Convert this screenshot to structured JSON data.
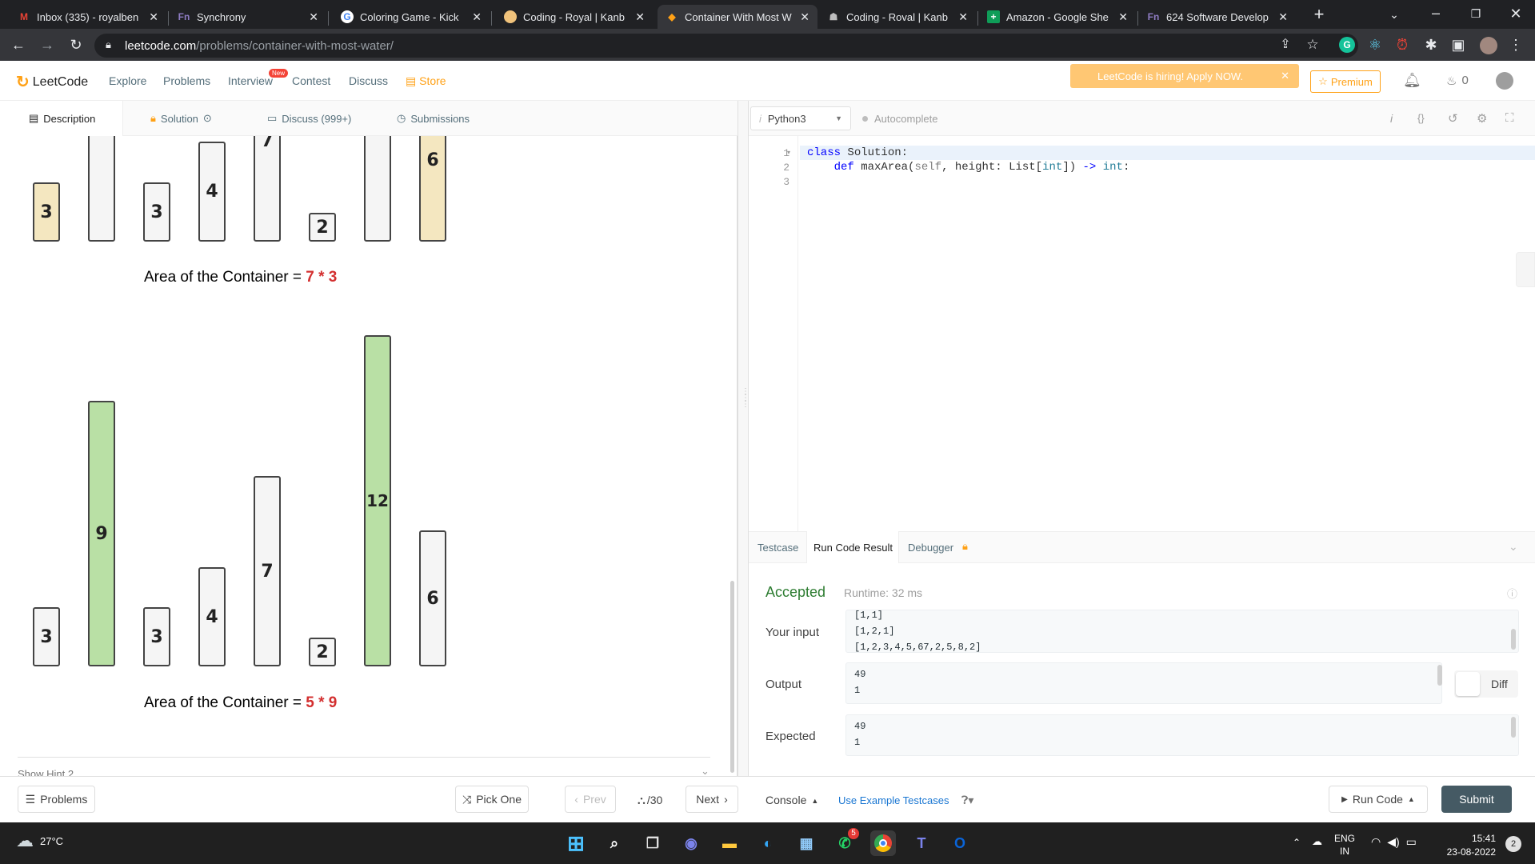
{
  "browser": {
    "tabs": [
      {
        "title": "Inbox (335) - royalben",
        "icon": "gmail-icon",
        "active": false
      },
      {
        "title": "Synchrony",
        "icon": "fn-icon",
        "active": false
      },
      {
        "title": "Coloring Game - Kick",
        "icon": "google-icon",
        "active": false
      },
      {
        "title": "Coding - Royal | Kanb",
        "icon": "avatar-icon",
        "active": false
      },
      {
        "title": "Container With Most W",
        "icon": "leetcode-icon",
        "active": true
      },
      {
        "title": "Coding - Roval | Kanb",
        "icon": "robot-icon",
        "active": false
      },
      {
        "title": "Amazon - Google She",
        "icon": "sheets-icon",
        "active": false
      },
      {
        "title": "624 Software Develop",
        "icon": "fn-icon",
        "active": false
      }
    ],
    "url_host": "leetcode.com",
    "url_path": "/problems/container-with-most-water/"
  },
  "nav": {
    "logo": "LeetCode",
    "links": [
      "Explore",
      "Problems",
      "Interview",
      "Contest",
      "Discuss"
    ],
    "new_badge": "New",
    "store": "Store",
    "hiring_banner": "LeetCode is hiring! Apply NOW.",
    "premium": "Premium",
    "streak": "0"
  },
  "problem_tabs": {
    "description": "Description",
    "solution": "Solution",
    "discuss": "Discuss (999+)",
    "submissions": "Submissions"
  },
  "description": {
    "figure1": {
      "bars": [
        "3",
        "",
        "3",
        "4",
        "7",
        "2",
        "",
        "6"
      ],
      "caption_prefix": "Area of the Container = ",
      "caption_value": "7 * 3"
    },
    "figure2": {
      "bars": [
        "3",
        "9",
        "3",
        "4",
        "7",
        "2",
        "12",
        "6"
      ],
      "caption_prefix": "Area of the Container = ",
      "caption_value": "5 * 9"
    },
    "hint": "Show Hint 2"
  },
  "editor": {
    "language": "Python3",
    "autocomplete": "Autocomplete",
    "line_numbers": [
      "1",
      "2",
      "3"
    ]
  },
  "console": {
    "tabs": [
      "Testcase",
      "Run Code Result",
      "Debugger"
    ],
    "status": "Accepted",
    "runtime": "Runtime: 32 ms",
    "input_label": "Your input",
    "input_lines": [
      "[1,1]",
      "[1,2,1]",
      "[1,2,3,4,5,67,2,5,8,2]"
    ],
    "output_label": "Output",
    "output_lines": [
      "49",
      "1"
    ],
    "expected_label": "Expected",
    "expected_lines": [
      "49",
      "1"
    ],
    "diff": "Diff"
  },
  "footer": {
    "problems": "Problems",
    "pick_one": "Pick One",
    "prev": "Prev",
    "counter": "/30",
    "next": "Next",
    "console": "Console",
    "use_example": "Use Example Testcases",
    "run_code": "Run Code",
    "submit": "Submit"
  },
  "taskbar": {
    "weather": "27°C",
    "lang_top": "ENG",
    "lang_bottom": "IN",
    "time": "15:41",
    "date": "23-08-2022",
    "notif_count": "2",
    "whatsapp_badge": "5"
  },
  "colors": {
    "accent_orange": "#ffa116",
    "accepted_green": "#2e7d32",
    "bar_green": "#b9e0a5",
    "bar_yellow": "#f4e7c0",
    "caption_red": "#d32f2f"
  }
}
